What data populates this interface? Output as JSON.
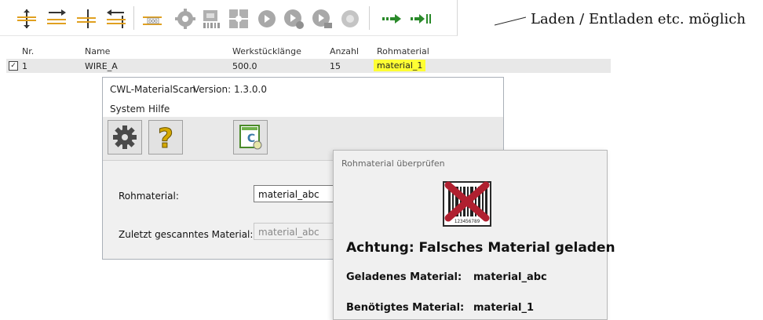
{
  "annotation": {
    "text": "Laden / Entladen etc. möglich"
  },
  "toolbar": {
    "icons": [
      "insert-above-icon",
      "insert-below-icon",
      "split-icon",
      "move-icon",
      "measure-icon",
      "gear-disabled-icon",
      "scan-disabled-icon",
      "expand-disabled-icon",
      "step-disabled-icon",
      "step-next-disabled-icon",
      "step-last-disabled-icon",
      "record-disabled-icon",
      "forward-icon",
      "forward-end-icon"
    ],
    "measure_label": "000"
  },
  "table": {
    "headers": {
      "nr": "Nr.",
      "name": "Name",
      "length": "Werkstücklänge",
      "count": "Anzahl",
      "material": "Rohmaterial"
    },
    "rows": [
      {
        "checked": true,
        "checkmark": "✓",
        "nr": "1",
        "name": "WIRE_A",
        "length": "500.0",
        "count": "15",
        "material": "material_1"
      }
    ],
    "highlight_color": "#ffff33"
  },
  "dialog": {
    "title": "CWL-MaterialScan",
    "version": "Version: 1.3.0.0",
    "menu": [
      "System",
      "Hilfe"
    ],
    "tools": {
      "settings_icon": "gear-icon",
      "help_icon": "question-icon",
      "scan_icon": "scan-config-icon",
      "help_glyph": "?",
      "scan_letter": "C"
    },
    "fields": {
      "rohmaterial_label": "Rohmaterial:",
      "rohmaterial_value": "material_abc",
      "last_scanned_label": "Zuletzt gescanntes Material:",
      "last_scanned_value": "material_abc"
    }
  },
  "popup": {
    "title": "Rohmaterial überprüfen",
    "barcode_digits": "123456789",
    "warning": "Achtung: Falsches Material geladen",
    "loaded_label": "Geladenes Material:",
    "loaded_value": "material_abc",
    "required_label": "Benötigtes Material:",
    "required_value": "material_1",
    "error_color": "#b02030"
  }
}
